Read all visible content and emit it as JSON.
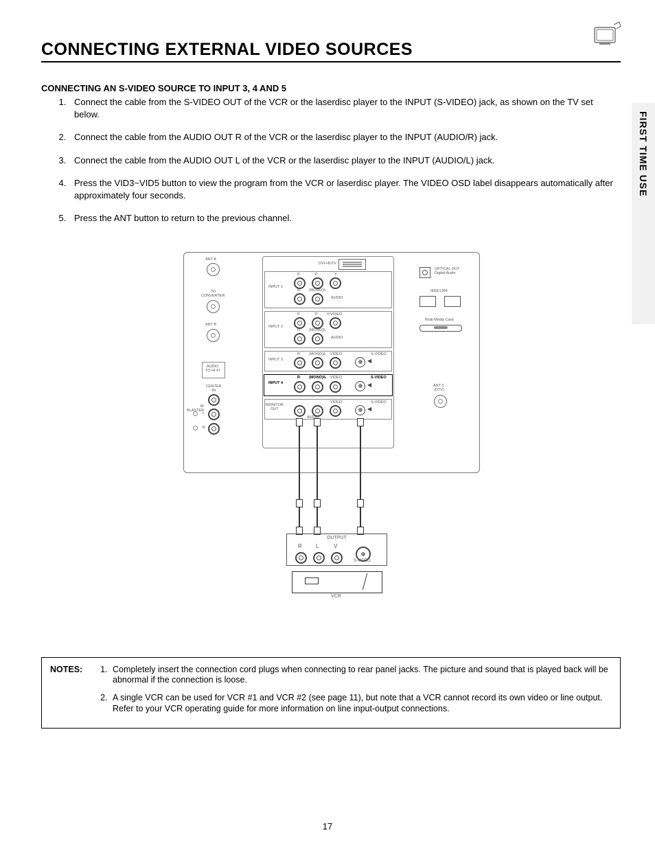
{
  "header": {
    "title": "CONNECTING EXTERNAL VIDEO SOURCES",
    "side_tab": "FIRST TIME USE"
  },
  "section": {
    "subtitle": "CONNECTING AN S-VIDEO SOURCE TO INPUT 3, 4 AND 5",
    "steps": [
      "Connect the cable from the S-VIDEO OUT of the VCR or the laserdisc player to the INPUT (S-VIDEO) jack, as shown on the TV set below.",
      "Connect the cable from the AUDIO OUT R of the VCR or the laserdisc player to the INPUT (AUDIO/R) jack.",
      "Connect the cable from the AUDIO OUT L of the VCR or the laserdisc player to the INPUT (AUDIO/L) jack.",
      "Press the VID3~VID5 button to view the program from the VCR or laserdisc player.  The VIDEO OSD label disappears automatically after approximately four seconds.",
      "Press the ANT button to return to the previous channel."
    ]
  },
  "diagram": {
    "left_col": {
      "ant_a": "ANT A",
      "to_conv": "TO\nCONVERTER",
      "ant_b": "ANT B",
      "audio_hifi": "AUDIO\nTO HI-FI",
      "center_in": "CENTER\nIN",
      "ir_blaster": "IR\nBLASTER",
      "l": "L",
      "r": "R"
    },
    "inputs": {
      "dvi": "DVI-HDTV",
      "input1": "INPUT 1",
      "input2": "INPUT 2",
      "input3": "INPUT 3",
      "input4": "INPUT 4",
      "monitor": "MONITOR\nOUT",
      "pr": "P",
      "pb": "P",
      "y": "Y",
      "yvideo": "Y/VIDEO",
      "r": "R",
      "mono_l": "(MONO)/L",
      "audio": "AUDIO",
      "video": "VIDEO",
      "svideo": "S-VIDEO"
    },
    "right_col": {
      "optical": "OPTICAL OUT\nDigital Audio",
      "ieee": "IEEE1394",
      "mmcard": "Multi Media Card",
      "ant_c": "ANT C\n(DTV)"
    },
    "vcr": {
      "output": "OUTPUT",
      "r": "R",
      "l": "L",
      "v": "V",
      "svideo": "S-VIDEO",
      "device": "VCR"
    }
  },
  "notes": {
    "label": "NOTES:",
    "items": [
      "Completely insert the connection cord plugs when connecting to rear panel jacks.  The picture and sound that is played back will be abnormal if the connection is loose.",
      "A single VCR can be used for VCR #1 and VCR #2 (see page 11), but note that a VCR cannot record its own video or line output.  Refer to your VCR operating guide for more information on line input-output connections."
    ]
  },
  "page_number": "17"
}
